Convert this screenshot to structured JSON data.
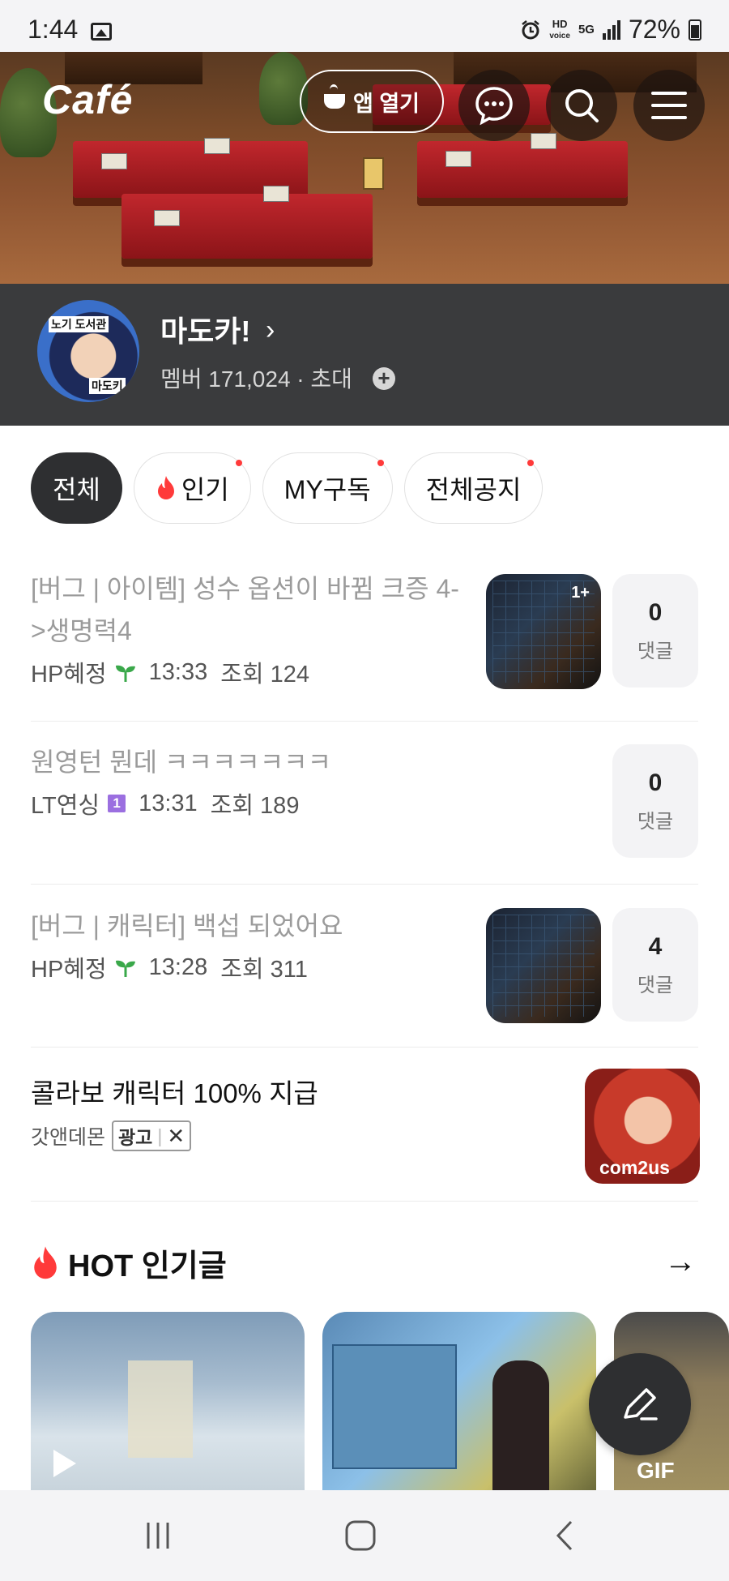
{
  "status_bar": {
    "time": "1:44",
    "hd_label": "HD",
    "voice_label": "voice",
    "network": "5G",
    "battery": "72%"
  },
  "header": {
    "logo": "Café",
    "open_app_label": "앱 열기",
    "icons": [
      "chat-icon",
      "search-icon",
      "menu-icon"
    ]
  },
  "cafe": {
    "name": "마도카!",
    "members": "멤버 171,024 · 초대",
    "avatar_text_top": "노기 도서관",
    "avatar_text_bottom": "마도키"
  },
  "tabs": [
    {
      "label": "전체",
      "active": true,
      "dot": false
    },
    {
      "label": "인기",
      "active": false,
      "dot": true
    },
    {
      "label": "MY구독",
      "active": false,
      "dot": true
    },
    {
      "label": "전체공지",
      "active": false,
      "dot": true
    }
  ],
  "posts": [
    {
      "title": "[버그 | 아이템] 성수 옵션이 바뀜 크증 4->생명력4",
      "author": "HP혜정",
      "badge": "sprout",
      "time": "13:33",
      "views": "조회 124",
      "thumb_badge": "1+",
      "comments": "0",
      "comments_label": "댓글"
    },
    {
      "title": "원영턴 뭔데 ㅋㅋㅋㅋㅋㅋㅋ",
      "author": "LT연싱",
      "badge": "1",
      "time": "13:31",
      "views": "조회 189",
      "comments": "0",
      "comments_label": "댓글"
    },
    {
      "title": "[버그 | 캐릭터] 백섭 되었어요",
      "author": "HP혜정",
      "badge": "sprout",
      "time": "13:28",
      "views": "조회 311",
      "comments": "4",
      "comments_label": "댓글"
    }
  ],
  "ad": {
    "title": "콜라보 캐릭터 100% 지급",
    "advertiser": "갓앤데몬",
    "badge": "광고",
    "thumb_logo": "com2us"
  },
  "hot": {
    "title": "HOT 인기글",
    "cards": [
      {
        "type": "video"
      },
      {
        "type": "image"
      },
      {
        "type": "gif",
        "label": "GIF"
      }
    ]
  },
  "colors": {
    "dark": "#2e2f31",
    "info_bg": "#3a3b3d",
    "accent_red": "#ff3a3a",
    "sprout_green": "#3aa84a",
    "level_purple": "#9b6fe0"
  }
}
